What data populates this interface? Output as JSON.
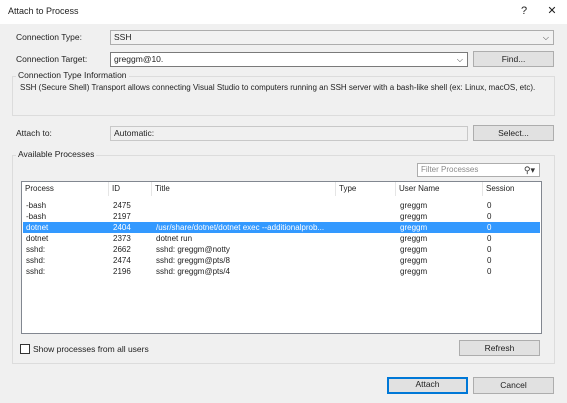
{
  "window": {
    "title": "Attach to Process",
    "help_label": "?",
    "close_label": "✕"
  },
  "connection": {
    "type_label": "Connection Type:",
    "type_value": "SSH",
    "target_label": "Connection Target:",
    "target_value": "greggm@10.",
    "find_label": "Find..."
  },
  "info": {
    "title": "Connection Type Information",
    "text": "SSH (Secure Shell) Transport allows connecting Visual Studio to computers running an SSH server with a bash-like shell (ex: Linux, macOS, etc)."
  },
  "attach": {
    "label": "Attach to:",
    "value": "Automatic:",
    "select_label": "Select..."
  },
  "processes": {
    "group_title": "Available Processes",
    "filter_placeholder": "Filter Processes",
    "columns": [
      "Process",
      "ID",
      "Title",
      "Type",
      "User Name",
      "Session"
    ],
    "rows": [
      {
        "process": "-bash",
        "id": "2475",
        "title": "",
        "type": "",
        "user": "greggm",
        "session": "0"
      },
      {
        "process": "-bash",
        "id": "2197",
        "title": "",
        "type": "",
        "user": "greggm",
        "session": "0"
      },
      {
        "process": "dotnet",
        "id": "2404",
        "title": "/usr/share/dotnet/dotnet exec --additionalprob...",
        "type": "",
        "user": "greggm",
        "session": "0"
      },
      {
        "process": "dotnet",
        "id": "2373",
        "title": "dotnet run",
        "type": "",
        "user": "greggm",
        "session": "0"
      },
      {
        "process": "sshd:",
        "id": "2662",
        "title": "sshd: greggm@notty",
        "type": "",
        "user": "greggm",
        "session": "0"
      },
      {
        "process": "sshd:",
        "id": "2474",
        "title": "sshd: greggm@pts/8",
        "type": "",
        "user": "greggm",
        "session": "0"
      },
      {
        "process": "sshd:",
        "id": "2196",
        "title": "sshd: greggm@pts/4",
        "type": "",
        "user": "greggm",
        "session": "0"
      }
    ],
    "selected_index": 2,
    "show_all_label": "Show processes from all users",
    "refresh_label": "Refresh"
  },
  "footer": {
    "attach_label": "Attach",
    "cancel_label": "Cancel"
  },
  "colors": {
    "selection": "#3399ff",
    "default_button_border": "#0078d7"
  },
  "icons": {
    "search": "search-icon",
    "close": "close-icon",
    "dropdown": "chevron-down-icon"
  }
}
